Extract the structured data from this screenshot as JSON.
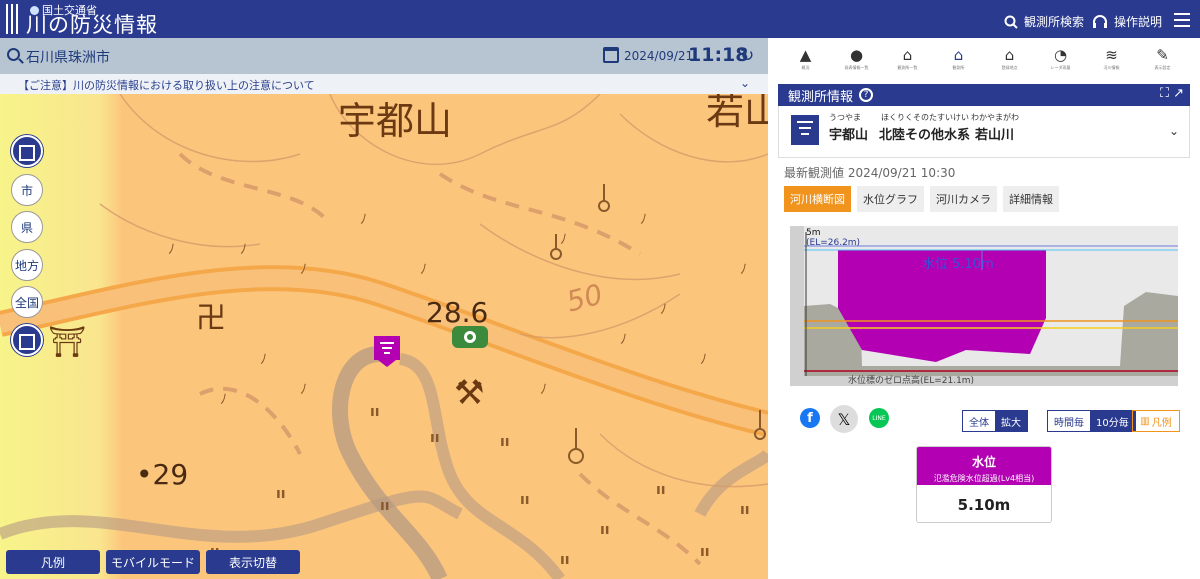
{
  "header": {
    "ministry": "国土交通省",
    "title": "川の防災情報",
    "search_label": "観測所検索",
    "help_label": "操作説明"
  },
  "map": {
    "location": "石川県珠洲市",
    "date": "2024/09/21",
    "time": "11:18",
    "notice": "【ご注意】川の防災情報における取り扱い上の注意について",
    "labels": {
      "place1": "宇都山",
      "place2": "若山",
      "elev1": "28.6",
      "elev2": "•29",
      "contour": "50"
    },
    "side_buttons": [
      "市",
      "県",
      "地方",
      "全国"
    ],
    "bottom_buttons": [
      "凡例",
      "モバイルモード",
      "表示切替"
    ]
  },
  "toolbar": {
    "icons": [
      {
        "icon": "warning-icon",
        "label": "概況"
      },
      {
        "icon": "alert-icon",
        "label": "発表情報一覧"
      },
      {
        "icon": "house-chart-icon",
        "label": "観測所一覧"
      },
      {
        "icon": "house-icon",
        "label": "観測所"
      },
      {
        "icon": "house-mark-icon",
        "label": "登録地点"
      },
      {
        "icon": "radar-icon",
        "label": "レーダ雨量"
      },
      {
        "icon": "wave-icon",
        "label": "河川情報"
      },
      {
        "icon": "tools-icon",
        "label": "表示設定"
      }
    ]
  },
  "panel": {
    "title": "観測所情報",
    "station": {
      "name_ruby": "うつやま",
      "name": "宇都山",
      "system_ruby": "ほくりくそのたすいけい",
      "system": "北陸その他水系",
      "river_ruby": "わかやまがわ",
      "river": "若山川"
    },
    "latest": "最新観測値 2024/09/21 10:30",
    "tabs": [
      "河川横断図",
      "水位グラフ",
      "河川カメラ",
      "詳細情報"
    ],
    "active_tab": 0,
    "cross_section": {
      "top_label": "5m",
      "el_top": "(EL=26.2m)",
      "water_label": "水位 5.10m",
      "zero_label": "水位標のゼロ点高(EL=21.1m)"
    },
    "share": {
      "facebook": "f",
      "x": "𝕏",
      "line": "LINE"
    },
    "scale_toggle": [
      "全体",
      "拡大"
    ],
    "interval_toggle": [
      "時間毎",
      "10分毎"
    ],
    "legend": "凡例",
    "water_level": {
      "title": "水位",
      "status": "氾濫危険水位超過(Lv4相当)",
      "value": "5.10m"
    }
  },
  "colors": {
    "header": "#2a3b8f",
    "accent": "#f0941e",
    "danger": "#b300b3",
    "map_base": "#fcc57c"
  }
}
